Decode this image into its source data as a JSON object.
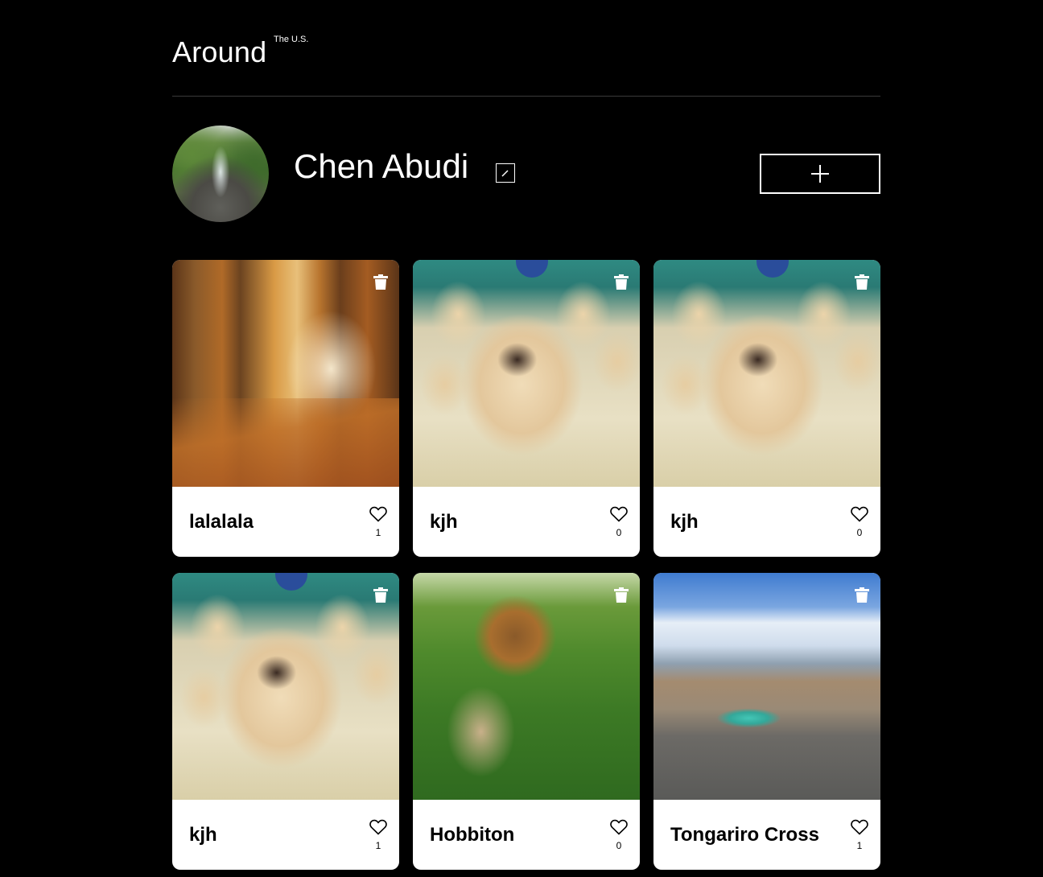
{
  "header": {
    "logo_main": "Around",
    "logo_sup": "The U.S."
  },
  "profile": {
    "name": "Chen Abudi"
  },
  "icons": {
    "edit": "pencil-icon",
    "add": "plus-icon",
    "delete": "trash-icon",
    "like": "heart-outline-icon"
  },
  "cards": [
    {
      "title": "lalalala",
      "likes": "1",
      "image": "autumn-forest-path"
    },
    {
      "title": "kjh",
      "likes": "0",
      "image": "labrador-puppies"
    },
    {
      "title": "kjh",
      "likes": "0",
      "image": "labrador-puppies"
    },
    {
      "title": "kjh",
      "likes": "1",
      "image": "labrador-puppies"
    },
    {
      "title": "Hobbiton",
      "likes": "0",
      "image": "hobbit-hole"
    },
    {
      "title": "Tongariro Cross",
      "likes": "1",
      "image": "volcanic-lake"
    }
  ]
}
